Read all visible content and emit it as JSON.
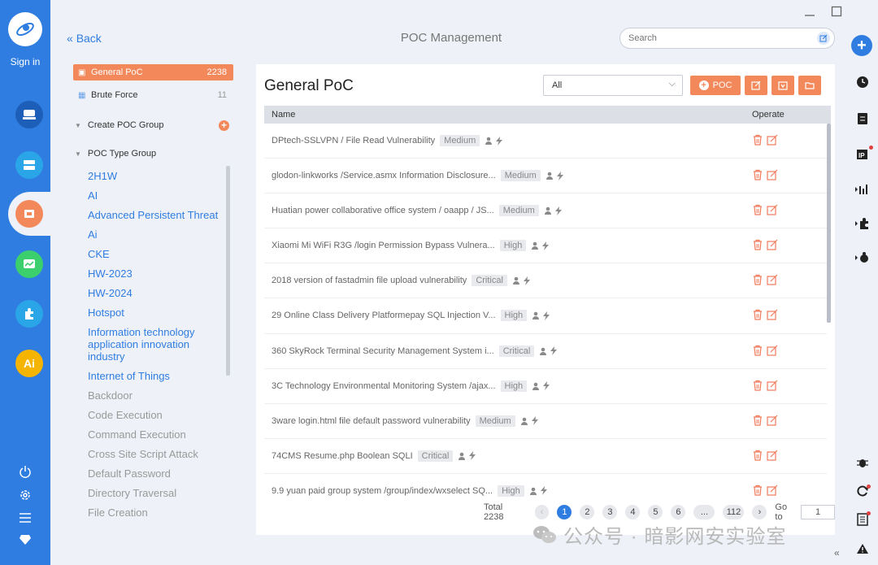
{
  "app": {
    "title": "POC Management",
    "back_label": "Back",
    "signin_label": "Sign in",
    "search_placeholder": "Search"
  },
  "left_rail": {
    "items": [
      "host-icon",
      "server-icon",
      "poc-icon",
      "monitor-icon",
      "plugin-icon",
      "ai-icon"
    ],
    "active": "poc-icon",
    "bottom_icons": [
      "power-icon",
      "settings-icon",
      "menu-icon",
      "diamond-icon"
    ]
  },
  "sidebar": {
    "groups": [
      {
        "label": "General PoC",
        "count": "2238",
        "active": true
      },
      {
        "label": "Brute Force",
        "count": "11",
        "active": false
      }
    ],
    "create_group_label": "Create POC Group",
    "type_group_label": "POC Type Group",
    "type_items": [
      {
        "label": "2H1W",
        "style": "blue"
      },
      {
        "label": "AI",
        "style": "blue"
      },
      {
        "label": "Advanced Persistent Threat",
        "style": "blue"
      },
      {
        "label": "Ai",
        "style": "blue"
      },
      {
        "label": "CKE",
        "style": "blue"
      },
      {
        "label": "HW-2023",
        "style": "blue"
      },
      {
        "label": "HW-2024",
        "style": "blue"
      },
      {
        "label": "Hotspot",
        "style": "blue"
      },
      {
        "label": "Information technology application innovation industry",
        "style": "blue"
      },
      {
        "label": "Internet of Things",
        "style": "blue"
      },
      {
        "label": "Backdoor",
        "style": "gray"
      },
      {
        "label": "Code Execution",
        "style": "gray"
      },
      {
        "label": "Command Execution",
        "style": "gray"
      },
      {
        "label": "Cross Site Script Attack",
        "style": "gray"
      },
      {
        "label": "Default Password",
        "style": "gray"
      },
      {
        "label": "Directory Traversal",
        "style": "gray"
      },
      {
        "label": "File Creation",
        "style": "gray"
      }
    ]
  },
  "main": {
    "title": "General PoC",
    "filter_value": "All",
    "add_poc_label": "POC",
    "toolbar_icons": [
      "export-icon",
      "import-icon",
      "folder-icon"
    ],
    "columns": {
      "name": "Name",
      "operate": "Operate"
    },
    "rows": [
      {
        "name": "DPtech-SSLVPN / File Read Vulnerability",
        "severity": "Medium"
      },
      {
        "name": "glodon-linkworks /Service.asmx Information Disclosure...",
        "severity": "Medium"
      },
      {
        "name": "Huatian power collaborative office system / oaapp / JS...",
        "severity": "Medium"
      },
      {
        "name": "Xiaomi Mi WiFi R3G /login Permission Bypass Vulnera...",
        "severity": "High"
      },
      {
        "name": "2018 version of fastadmin file upload vulnerability",
        "severity": "Critical"
      },
      {
        "name": "29 Online Class Delivery Platformepay SQL Injection V...",
        "severity": "High"
      },
      {
        "name": "360 SkyRock Terminal Security Management System i...",
        "severity": "Critical"
      },
      {
        "name": "3C Technology Environmental Monitoring System /ajax...",
        "severity": "High"
      },
      {
        "name": "3ware login.html file default password vulnerability",
        "severity": "Medium"
      },
      {
        "name": "74CMS Resume.php Boolean SQLI",
        "severity": "Critical"
      },
      {
        "name": "9.9 yuan paid group system /group/index/wxselect SQ...",
        "severity": "High"
      }
    ],
    "pagination": {
      "total_label": "Total 2238",
      "pages": [
        "1",
        "2",
        "3",
        "4",
        "5",
        "6",
        "...",
        "112"
      ],
      "current": "1",
      "goto_label": "Go to",
      "goto_value": "1"
    }
  },
  "right_rail": {
    "icons": [
      "add-icon",
      "history-icon",
      "document-icon",
      "ip-icon",
      "chart-icon",
      "plugin-icon",
      "bug-icon",
      "beetle-icon",
      "refresh-icon",
      "report-icon",
      "warning-icon"
    ]
  },
  "watermark": "公众号 · 暗影网安实验室",
  "colors": {
    "primary": "#2f7de1",
    "accent": "#f3895b"
  }
}
